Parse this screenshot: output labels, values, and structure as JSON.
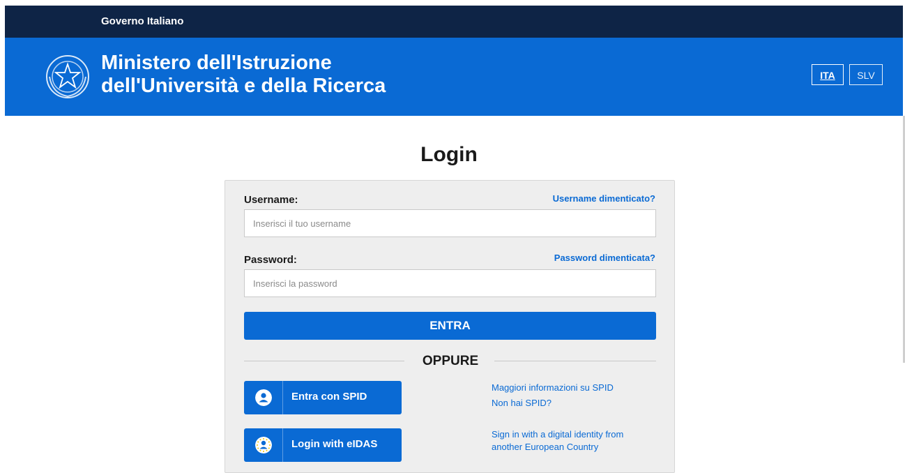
{
  "topbar": {
    "label": "Governo Italiano"
  },
  "header": {
    "title_line1": "Ministero dell'Istruzione",
    "title_line2": "dell'Università e della Ricerca",
    "languages": [
      {
        "label": "ITA",
        "active": true
      },
      {
        "label": "SLV",
        "active": false
      }
    ]
  },
  "login": {
    "title": "Login",
    "username_label": "Username:",
    "username_forgot": "Username dimenticato?",
    "username_placeholder": "Inserisci il tuo username",
    "password_label": "Password:",
    "password_forgot": "Password dimenticata?",
    "password_placeholder": "Inserisci la password",
    "submit_label": "ENTRA",
    "divider_label": "OPPURE"
  },
  "spid": {
    "button_label": "Entra con SPID",
    "info_link": "Maggiori informazioni su SPID",
    "no_spid_link": "Non hai SPID?"
  },
  "eidas": {
    "button_label": "Login with eIDAS",
    "info_line1": "Sign in with a digital identity from",
    "info_line2": "another European Country"
  },
  "colors": {
    "topbar": "#0e2446",
    "brand_blue": "#0a6ad4",
    "card_bg": "#eeeeee"
  },
  "icons": [
    "italian-emblem",
    "spid-user-icon",
    "eidas-eu-icon"
  ]
}
